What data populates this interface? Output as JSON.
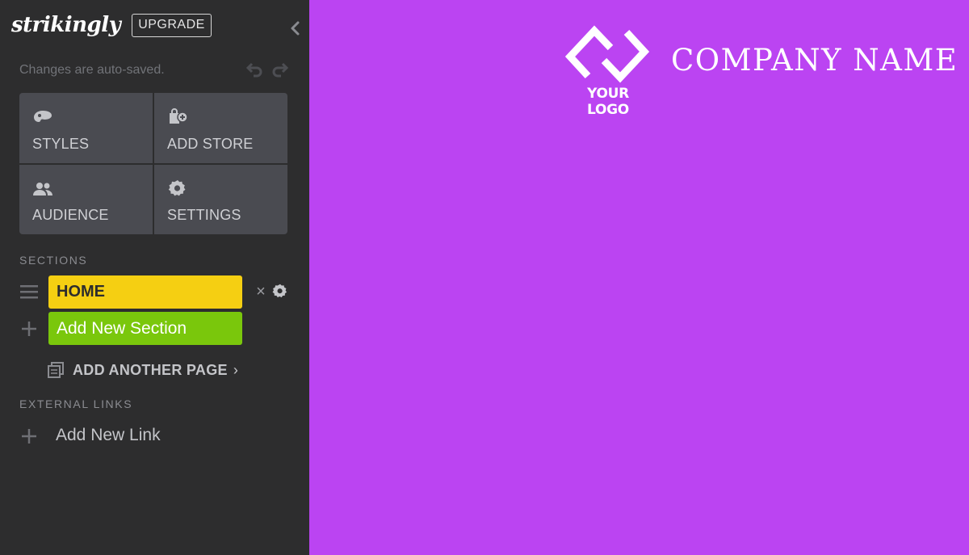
{
  "sidebar": {
    "brand": "strikingly",
    "upgrade_label": "UPGRADE",
    "autosave_text": "Changes are auto-saved.",
    "tools": [
      {
        "label": "STYLES",
        "icon": "palette-icon"
      },
      {
        "label": "ADD STORE",
        "icon": "store-bag-icon"
      },
      {
        "label": "AUDIENCE",
        "icon": "people-icon"
      },
      {
        "label": "SETTINGS",
        "icon": "gear-icon"
      }
    ],
    "sections_title": "SECTIONS",
    "sections": [
      {
        "label": "HOME"
      }
    ],
    "add_section_label": "Add New Section",
    "add_page_label": "ADD ANOTHER PAGE",
    "add_page_chevron": "›",
    "external_links_title": "EXTERNAL LINKS",
    "add_link_label": "Add New Link",
    "remove_symbol": "×"
  },
  "canvas": {
    "logo_text": "YOUR LOGO",
    "company_name": "COMPANY NAME"
  },
  "colors": {
    "sidebar_bg": "#2d2d2e",
    "tool_bg": "#4a4b51",
    "home_section": "#f5cf12",
    "add_section": "#7ac70c",
    "canvas_bg": "#bb44f2"
  }
}
